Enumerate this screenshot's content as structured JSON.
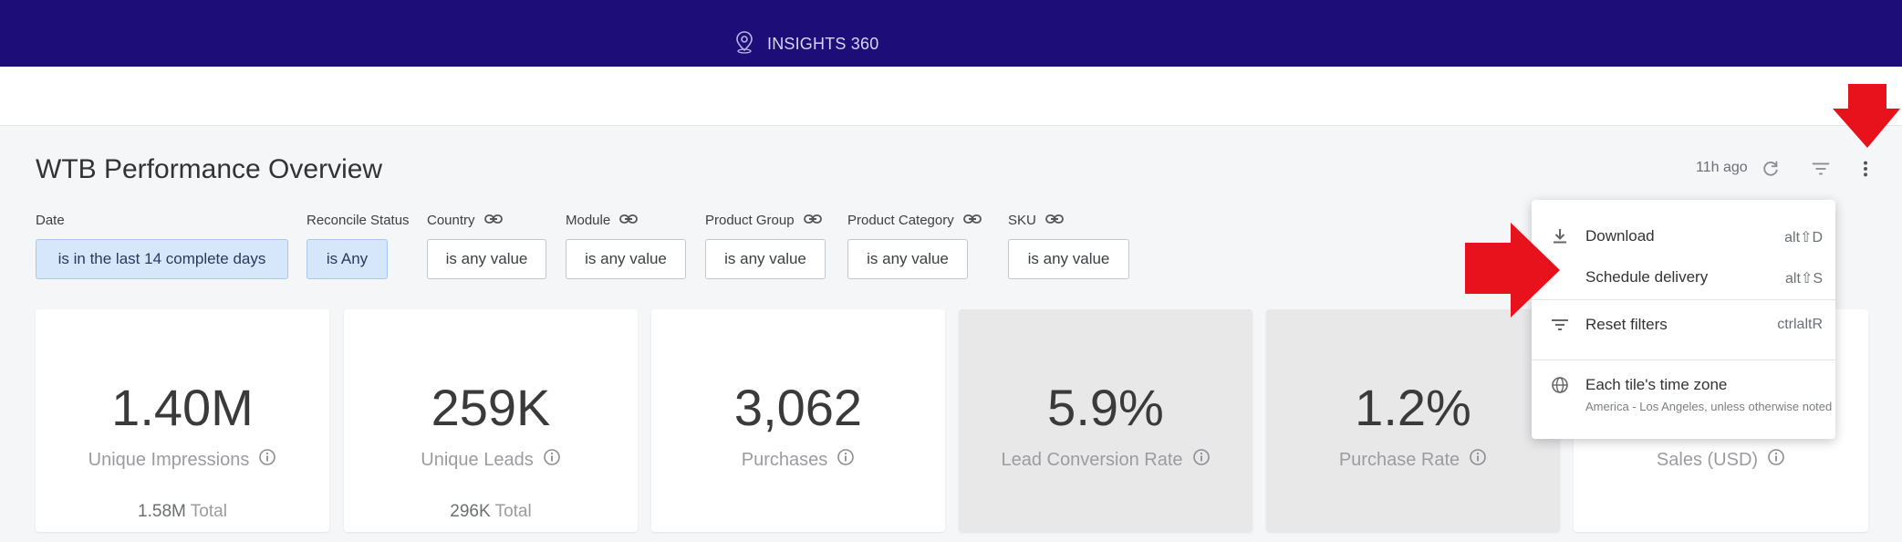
{
  "app": {
    "brand": "INSIGHTS 360"
  },
  "dashboard": {
    "title": "WTB Performance Overview",
    "updated": "11h ago"
  },
  "filters": [
    {
      "label": "Date",
      "value": "is in the last 14 complete days",
      "active": true,
      "linked": false
    },
    {
      "label": "Reconcile Status",
      "value": "is Any",
      "active": true,
      "linked": false
    },
    {
      "label": "Country",
      "value": "is any value",
      "active": false,
      "linked": true
    },
    {
      "label": "Module",
      "value": "is any value",
      "active": false,
      "linked": true
    },
    {
      "label": "Product Group",
      "value": "is any value",
      "active": false,
      "linked": true
    },
    {
      "label": "Product Category",
      "value": "is any value",
      "active": false,
      "linked": true
    },
    {
      "label": "SKU",
      "value": "is any value",
      "active": false,
      "linked": true
    }
  ],
  "tiles": [
    {
      "value": "1.40M",
      "label": "Unique Impressions",
      "total_value": "1.58M",
      "total_word": "Total"
    },
    {
      "value": "259K",
      "label": "Unique Leads",
      "total_value": "296K",
      "total_word": "Total"
    },
    {
      "value": "3,062",
      "label": "Purchases",
      "total_value": "",
      "total_word": ""
    },
    {
      "value": "5.9%",
      "label": "Lead Conversion Rate",
      "total_value": "",
      "total_word": ""
    },
    {
      "value": "1.2%",
      "label": "Purchase Rate",
      "total_value": "",
      "total_word": ""
    },
    {
      "value": "",
      "label": "Sales (USD)",
      "total_value": "",
      "total_word": ""
    }
  ],
  "menu": {
    "download": {
      "label": "Download",
      "shortcut": "alt⇧D"
    },
    "schedule": {
      "label": "Schedule delivery",
      "shortcut": "alt⇧S"
    },
    "reset": {
      "label": "Reset filters",
      "shortcut": "ctrlaltR"
    },
    "timezone": {
      "label": "Each tile's time zone",
      "sub": "America - Los Angeles, unless otherwise noted"
    }
  },
  "colors": {
    "topbar": "#1c0d78",
    "annotation_arrow": "#e8121d",
    "active_chip": "#d6e6fb"
  },
  "icons": [
    "location-pin-icon",
    "refresh-icon",
    "filter-icon",
    "more-vert-icon",
    "link-icon",
    "info-icon",
    "download-icon",
    "globe-icon"
  ]
}
